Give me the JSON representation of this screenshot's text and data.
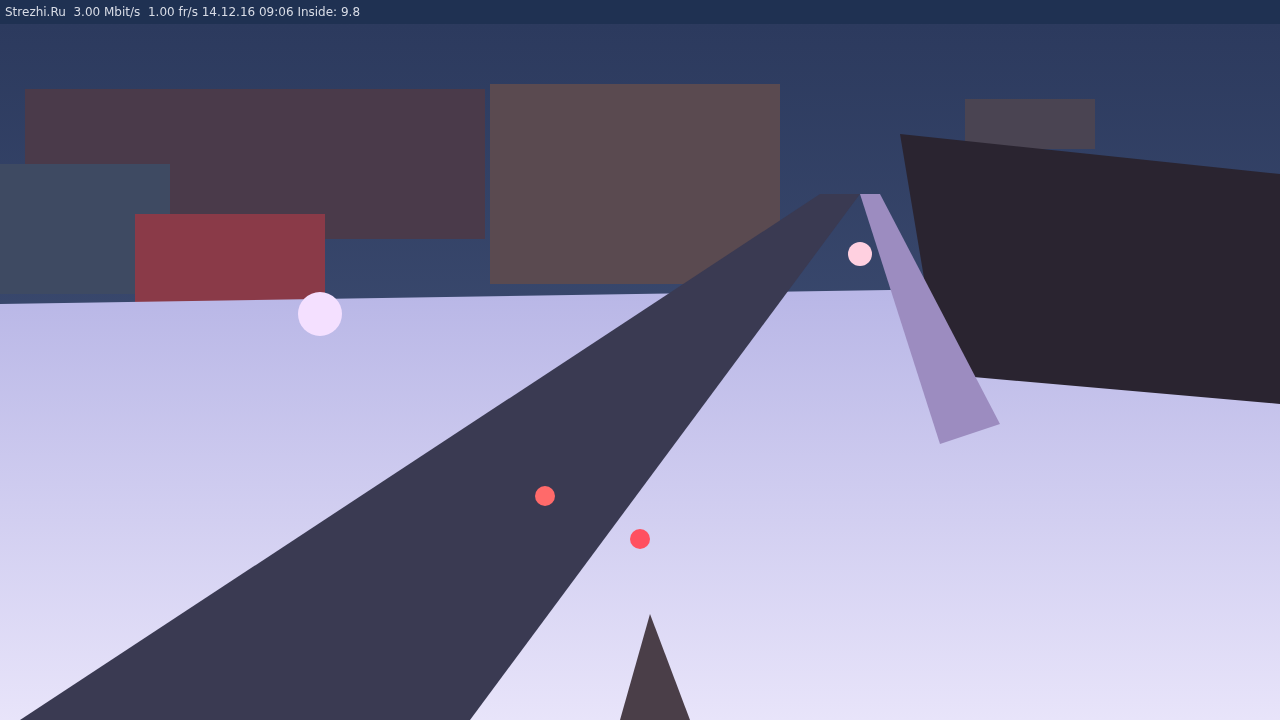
{
  "camera_overlay": {
    "text": "Strezhi.Ru  3.00 Mbit/s  1.00 fr/s 14.12.16 09:06 Inside: 9.8"
  }
}
